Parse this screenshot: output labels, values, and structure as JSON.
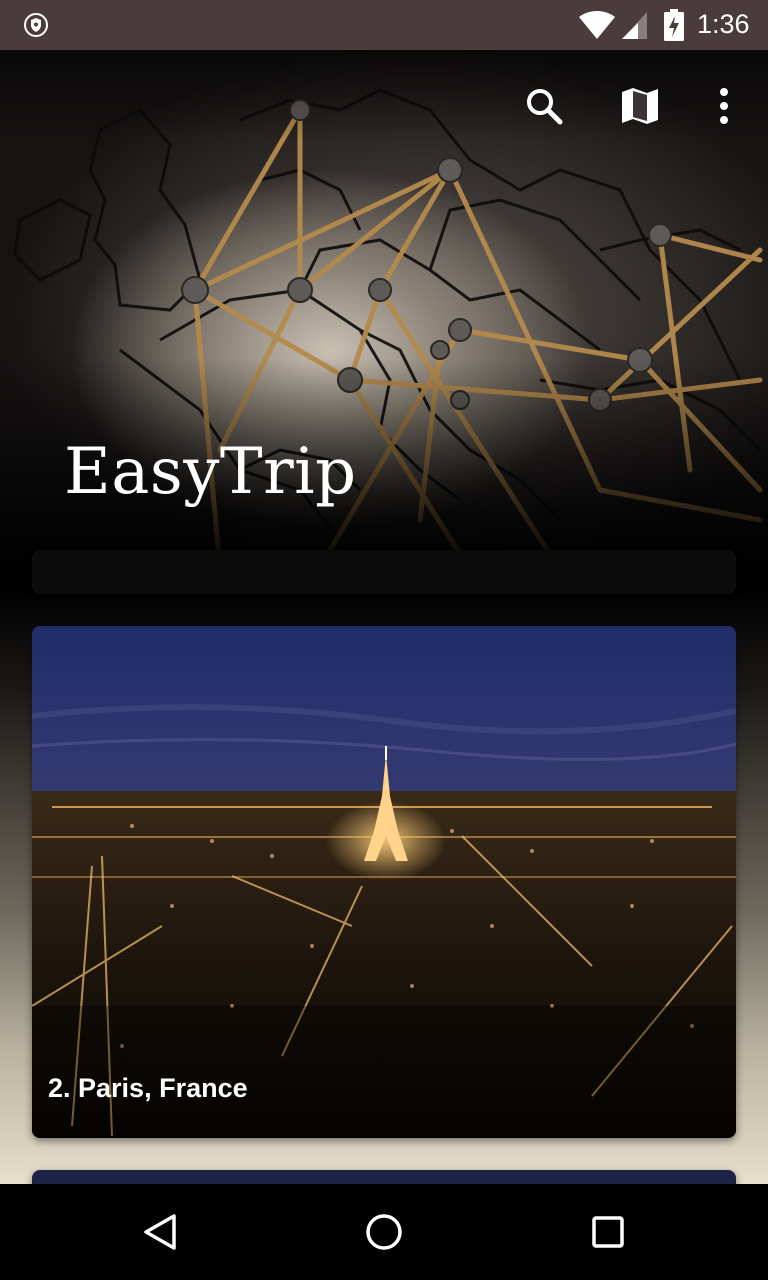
{
  "status_bar": {
    "time": "1:36",
    "icons": [
      "vpn-shield-icon",
      "wifi-icon",
      "cell-signal-icon",
      "battery-charging-icon"
    ]
  },
  "header": {
    "title": "EasyTrip",
    "actions": [
      "search-icon",
      "map-icon",
      "overflow-menu-icon"
    ]
  },
  "destinations": [
    {
      "label": "2. Paris, France"
    }
  ],
  "nav_bar": {
    "buttons": [
      "back-icon",
      "home-icon",
      "recents-icon"
    ]
  },
  "colors": {
    "status_bar": "#4a3b3c",
    "nav_bar": "#000000",
    "text": "#ffffff"
  }
}
